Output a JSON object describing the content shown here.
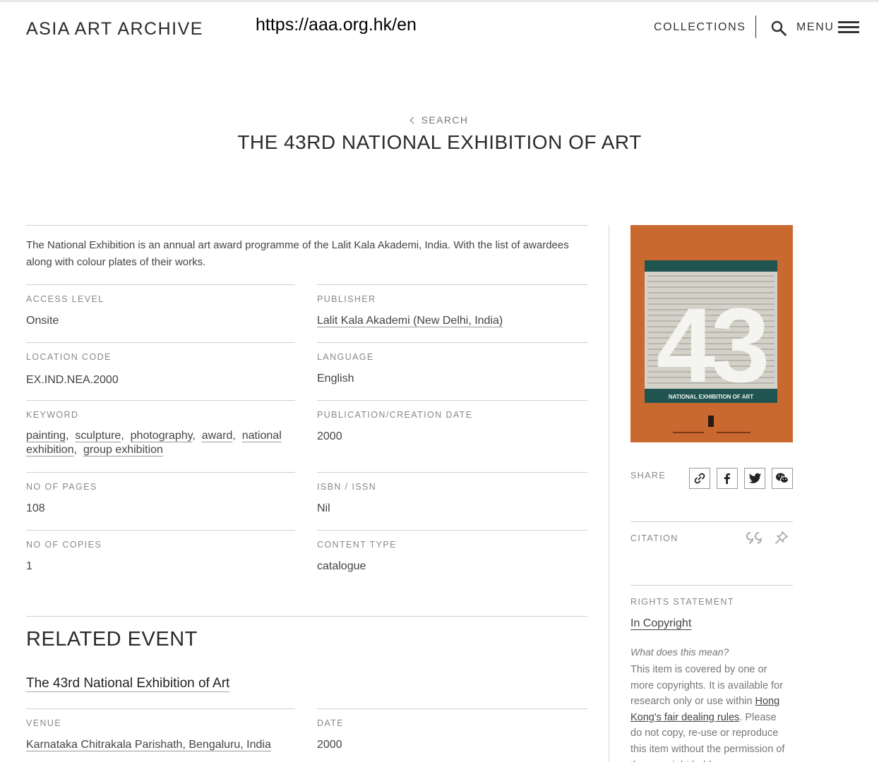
{
  "header": {
    "logo": "ASIA ART ARCHIVE",
    "url": "https://aaa.org.hk/en",
    "collections": "COLLECTIONS",
    "menu": "MENU"
  },
  "page": {
    "back_label": "SEARCH",
    "title": "THE 43RD NATIONAL EXHIBITION OF ART",
    "description": "The National Exhibition is an annual art award programme of the Lalit Kala Akademi, India. With the list of awardees along with colour plates of their works."
  },
  "fields": {
    "access_level": {
      "label": "ACCESS LEVEL",
      "value": "Onsite"
    },
    "publisher": {
      "label": "PUBLISHER",
      "value": "Lalit Kala Akademi (New Delhi, India)"
    },
    "location_code": {
      "label": "LOCATION CODE",
      "value": "EX.IND.NEA.2000"
    },
    "language": {
      "label": "LANGUAGE",
      "value": "English"
    },
    "keyword": {
      "label": "KEYWORD",
      "items": [
        "painting",
        "sculpture",
        "photography",
        "award",
        "national exhibition",
        "group exhibition"
      ]
    },
    "pub_date": {
      "label": "PUBLICATION/CREATION DATE",
      "value": "2000"
    },
    "pages": {
      "label": "NO OF PAGES",
      "value": "108"
    },
    "isbn": {
      "label": "ISBN / ISSN",
      "value": "Nil"
    },
    "copies": {
      "label": "NO OF COPIES",
      "value": "1"
    },
    "content_type": {
      "label": "CONTENT TYPE",
      "value": "catalogue"
    }
  },
  "related": {
    "heading": "RELATED EVENT",
    "event_title": "The 43rd National Exhibition of Art",
    "venue_label": "VENUE",
    "venue": "Karnataka Chitrakala Parishath, Bengaluru, India",
    "date_label": "DATE",
    "date": "2000"
  },
  "sidebar": {
    "cover": {
      "number": "43",
      "banner": "NATIONAL EXHIBITION OF ART",
      "bg_color": "#c9682f",
      "band_color": "#1f5450"
    },
    "share_label": "SHARE",
    "share_icons": [
      "link-icon",
      "facebook-icon",
      "twitter-icon",
      "wechat-icon"
    ],
    "citation_label": "CITATION",
    "citation_icons": [
      "quote-icon",
      "pin-icon"
    ],
    "rights_label": "RIGHTS STATEMENT",
    "rights_value": "In Copyright",
    "rights_question": "What does this mean?",
    "rights_text_1": "This item is covered by one or more copyrights. It is available for research only or use within ",
    "rights_link": "Hong Kong's fair dealing rules",
    "rights_text_2": ". Please do not copy, re-use or reproduce this item without the permission of the copyright holder."
  }
}
